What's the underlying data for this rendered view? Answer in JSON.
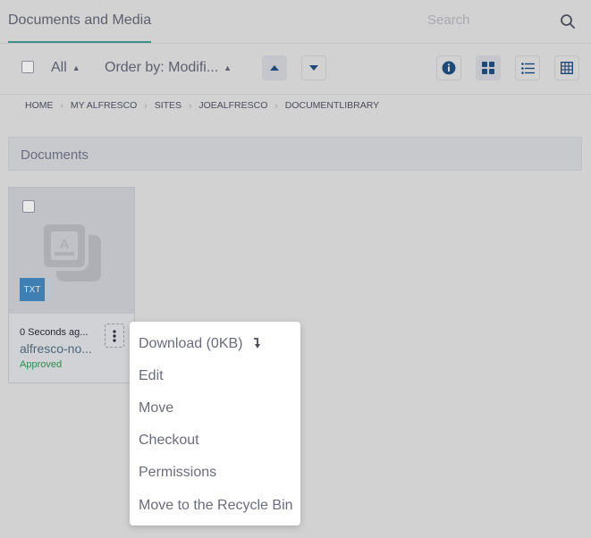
{
  "header": {
    "tab_label": "Documents and Media",
    "search_placeholder": "Search"
  },
  "toolbar": {
    "filter_label": "All",
    "order_label": "Order by: Modifi..."
  },
  "breadcrumb": [
    "HOME",
    "MY ALFRESCO",
    "SITES",
    "JOEALFRESCO",
    "DOCUMENTLIBRARY"
  ],
  "section": {
    "title": "Documents"
  },
  "card": {
    "file_type": "TXT",
    "time": "0 Seconds ag...",
    "name": "alfresco-no...",
    "status": "Approved",
    "colors": {
      "badge": "#3f7fb4",
      "status": "#2f8a4f"
    }
  },
  "menu": {
    "items": [
      {
        "label": "Download (0KB)",
        "icon": "download-arrow-icon"
      },
      {
        "label": "Edit"
      },
      {
        "label": "Move"
      },
      {
        "label": "Checkout"
      },
      {
        "label": "Permissions"
      },
      {
        "label": "Move to the Recycle Bin"
      }
    ]
  },
  "colors": {
    "accent": "#3e8f86",
    "info_icon": "#1e4a7a"
  }
}
